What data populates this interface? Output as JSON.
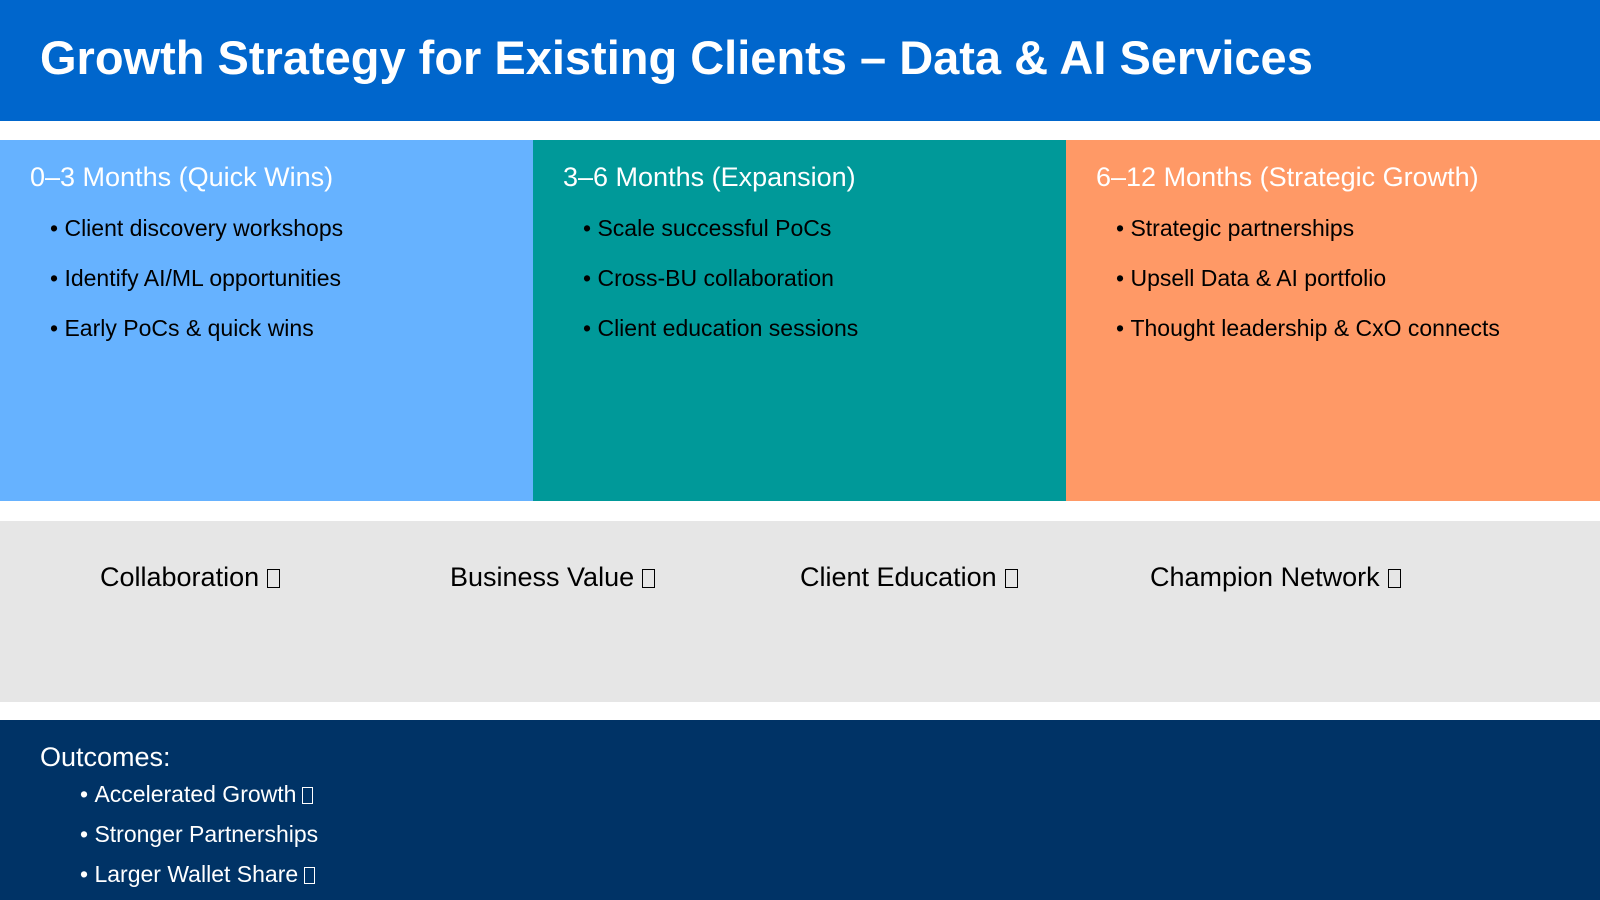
{
  "title": "Growth Strategy for Existing Clients – Data & AI Services",
  "phases": [
    {
      "heading": "0–3 Months (Quick Wins)",
      "items": [
        "Client discovery workshops",
        "Identify AI/ML opportunities",
        "Early PoCs & quick wins"
      ]
    },
    {
      "heading": "3–6 Months (Expansion)",
      "items": [
        "Scale successful PoCs",
        "Cross-BU collaboration",
        "Client education sessions"
      ]
    },
    {
      "heading": "6–12 Months (Strategic Growth)",
      "items": [
        "Strategic partnerships",
        "Upsell Data & AI portfolio",
        "Thought leadership & CxO connects"
      ]
    }
  ],
  "pillars": [
    "Collaboration",
    "Business Value",
    "Client Education",
    "Champion Network"
  ],
  "outcomes": {
    "heading": "Outcomes:",
    "items": [
      "Accelerated Growth",
      "Stronger Partnerships",
      "Larger Wallet Share"
    ]
  },
  "colors": {
    "title_bar": "#0066CC",
    "phase_1": "#66B2FF",
    "phase_2": "#009999",
    "phase_3": "#FF9966",
    "pillars_band": "#E6E6E6",
    "outcomes_band": "#003366"
  },
  "icons": {
    "missing_glyph": "missing-glyph-box-icon"
  }
}
